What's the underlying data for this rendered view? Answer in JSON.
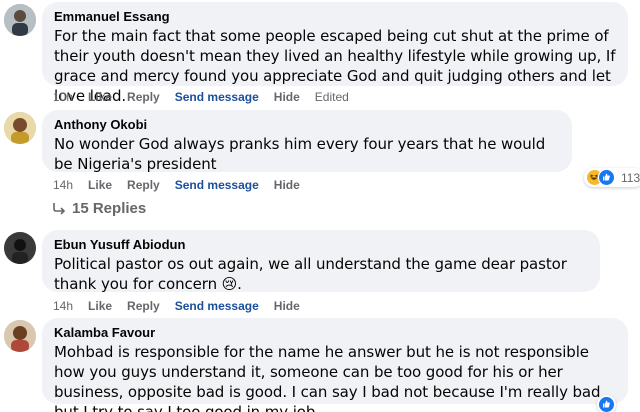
{
  "comments": [
    {
      "author": "Emmanuel Essang",
      "text": "For the main fact that some people escaped being cut shut at the prime of their youth doesn't mean they lived an healthy lifestyle while growing up, If grace and mercy found you appreciate God and quit judging others and let love lead.",
      "time": "10h",
      "like": "Like",
      "reply": "Reply",
      "send_message": "Send message",
      "hide": "Hide",
      "edited": "Edited"
    },
    {
      "author": "Anthony Okobi",
      "text": "No wonder God always pranks him every four years that he would be Nigeria's president",
      "time": "14h",
      "like": "Like",
      "reply": "Reply",
      "send_message": "Send message",
      "hide": "Hide",
      "reaction_count": "113",
      "reaction_icons": [
        "haha-icon",
        "like-icon"
      ],
      "replies_label": "15 Replies"
    },
    {
      "author": "Ebun Yusuff Abiodun",
      "text": "Political pastor os out again, we all understand the game dear pastor thank you for concern 😢.",
      "time": "14h",
      "like": "Like",
      "reply": "Reply",
      "send_message": "Send message",
      "hide": "Hide"
    },
    {
      "author": "Kalamba Favour",
      "text": "Mohbad is responsible for the name he answer but he is not responsible how you guys understand it, someone can be too good for his or her business, opposite bad is good. I can say I bad not because I'm really bad but I try to say I too good in my job.,..",
      "reaction_icons": [
        "like-icon"
      ]
    }
  ],
  "colors": {
    "bubble": "#f0f2f5",
    "meta": "#65676b",
    "send_message": "#1b4f9c",
    "like_blue": "#1877f2",
    "haha_yellow": "#f7b928"
  }
}
